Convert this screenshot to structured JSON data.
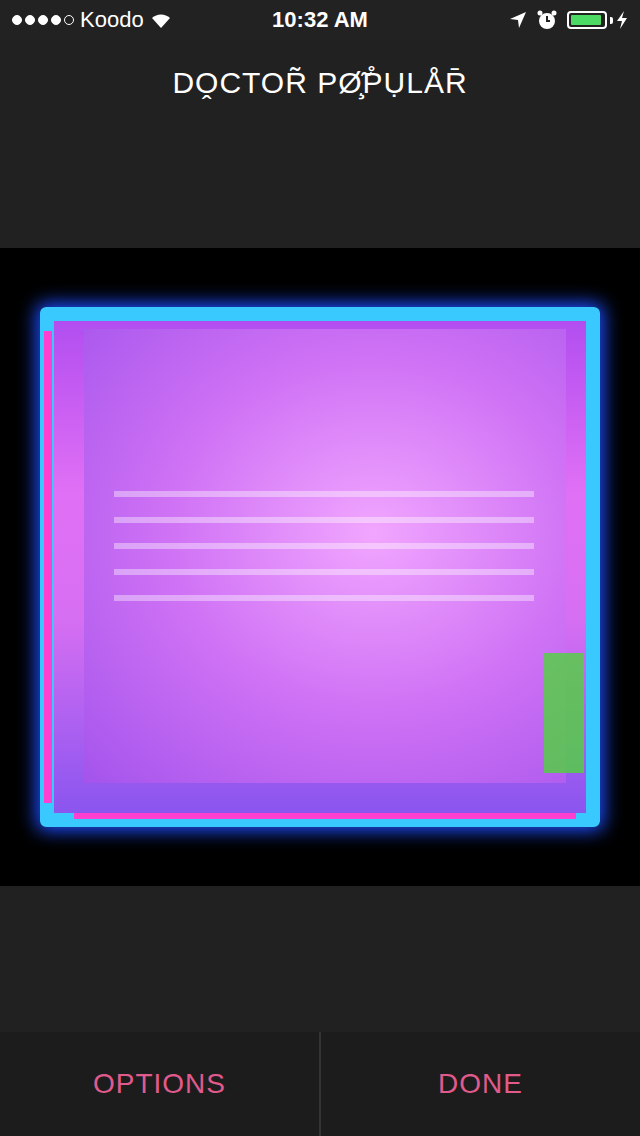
{
  "status_bar": {
    "carrier": "Koodo",
    "signal": {
      "level": 0.8
    },
    "time": "10:32 AM",
    "battery": {
      "level": 0.95,
      "charging": true
    }
  },
  "header": {
    "title": "DO̭CTOR̃ PØ̧̃P̊ỤLÅR̄"
  },
  "buttons": [
    {
      "label": "OPTIONS"
    },
    {
      "label": "DONE"
    }
  ]
}
